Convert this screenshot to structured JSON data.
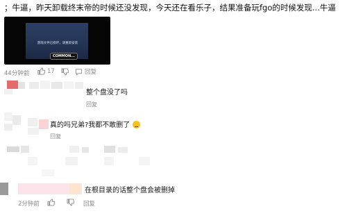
{
  "post": {
    "text": "；牛逼，昨天卸载终末帝的时候还没发现，今天还在看乐子，结果准备玩fgo的时候发现...牛逼",
    "video": {
      "dialog_text": "游戏文件已损坏，请重新安装",
      "logo_text": "COMMON..."
    },
    "time": "44分钟前",
    "likes": "17"
  },
  "comments": [
    {
      "text": "整个盘没了吗",
      "reply_label": "回复"
    },
    {
      "text": "真的吗兄弟?我都不敢删了",
      "reply_label": "回复"
    },
    {
      "text": "在根目录的话整个盘会被删掉",
      "time": "2分钟前",
      "reply_label": "回复"
    }
  ],
  "labels": {
    "reply": "回复"
  },
  "icons": [
    "thumb-up-icon",
    "thumb-down-icon",
    "comment-icon"
  ]
}
